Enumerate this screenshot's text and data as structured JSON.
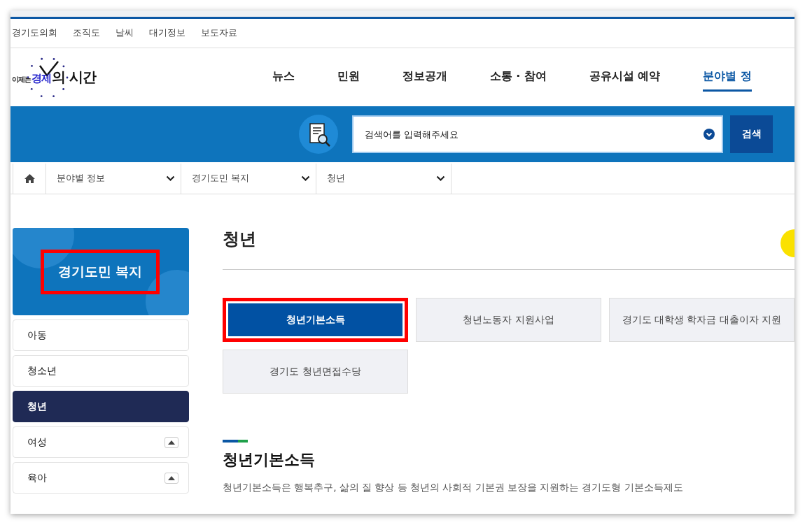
{
  "util_links": [
    "경기도의회",
    "조직도",
    "날씨",
    "대기정보",
    "보도자료"
  ],
  "logo": {
    "prefix": "이제는",
    "accent": "경제",
    "suffix": "의 시간"
  },
  "nav": [
    {
      "label": "뉴스",
      "selected": false
    },
    {
      "label": "민원",
      "selected": false
    },
    {
      "label": "정보공개",
      "selected": false
    },
    {
      "label": "소통 · 참여",
      "selected": false
    },
    {
      "label": "공유시설 예약",
      "selected": false
    },
    {
      "label": "분야별 정",
      "selected": true
    }
  ],
  "search": {
    "placeholder": "검색어를 입력해주세요",
    "button": "검색"
  },
  "breadcrumb": [
    "분야별 정보",
    "경기도민 복지",
    "청년"
  ],
  "sidebar": {
    "title": "경기도민 복지",
    "highlighted": true,
    "items": [
      {
        "label": "아동",
        "selected": false,
        "expandable": false
      },
      {
        "label": "청소년",
        "selected": false,
        "expandable": false
      },
      {
        "label": "청년",
        "selected": true,
        "expandable": false
      },
      {
        "label": "여성",
        "selected": false,
        "expandable": true
      },
      {
        "label": "육아",
        "selected": false,
        "expandable": true
      }
    ]
  },
  "page_title": "청년",
  "tabs": [
    {
      "label": "청년기본소득",
      "selected": true,
      "highlighted": true
    },
    {
      "label": "청년노동자 지원사업",
      "selected": false,
      "highlighted": false
    },
    {
      "label": "경기도 대학생 학자금 대출이자 지원",
      "selected": false,
      "highlighted": false
    },
    {
      "label": "경기도 청년면접수당",
      "selected": false,
      "highlighted": false
    }
  ],
  "section": {
    "heading": "청년기본소득",
    "description": "청년기본소득은 행복추구, 삶의 질 향상 등 청년의 사회적 기본권 보장을 지원하는 경기도형 기본소득제도"
  }
}
